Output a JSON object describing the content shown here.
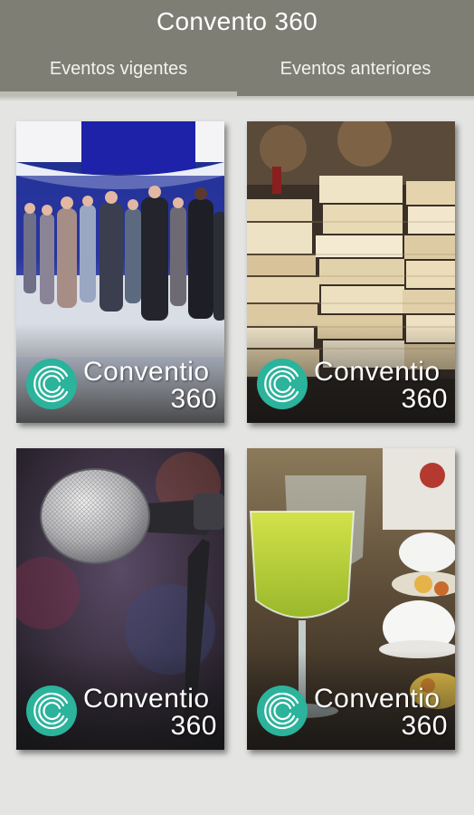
{
  "app": {
    "title": "Convento 360",
    "accent_color": "#2bb39b"
  },
  "tabs": [
    {
      "label": "Eventos vigentes",
      "active": true
    },
    {
      "label": "Eventos anteriores",
      "active": false
    }
  ],
  "cards": [
    {
      "brand_name": "Conventio",
      "brand_number": "360",
      "image": "networking-event-photo"
    },
    {
      "brand_name": "Conventio",
      "brand_number": "360",
      "image": "stacked-books-photo"
    },
    {
      "brand_name": "Conventio",
      "brand_number": "360",
      "image": "microphone-photo"
    },
    {
      "brand_name": "Conventio",
      "brand_number": "360",
      "image": "drinks-table-photo"
    }
  ]
}
